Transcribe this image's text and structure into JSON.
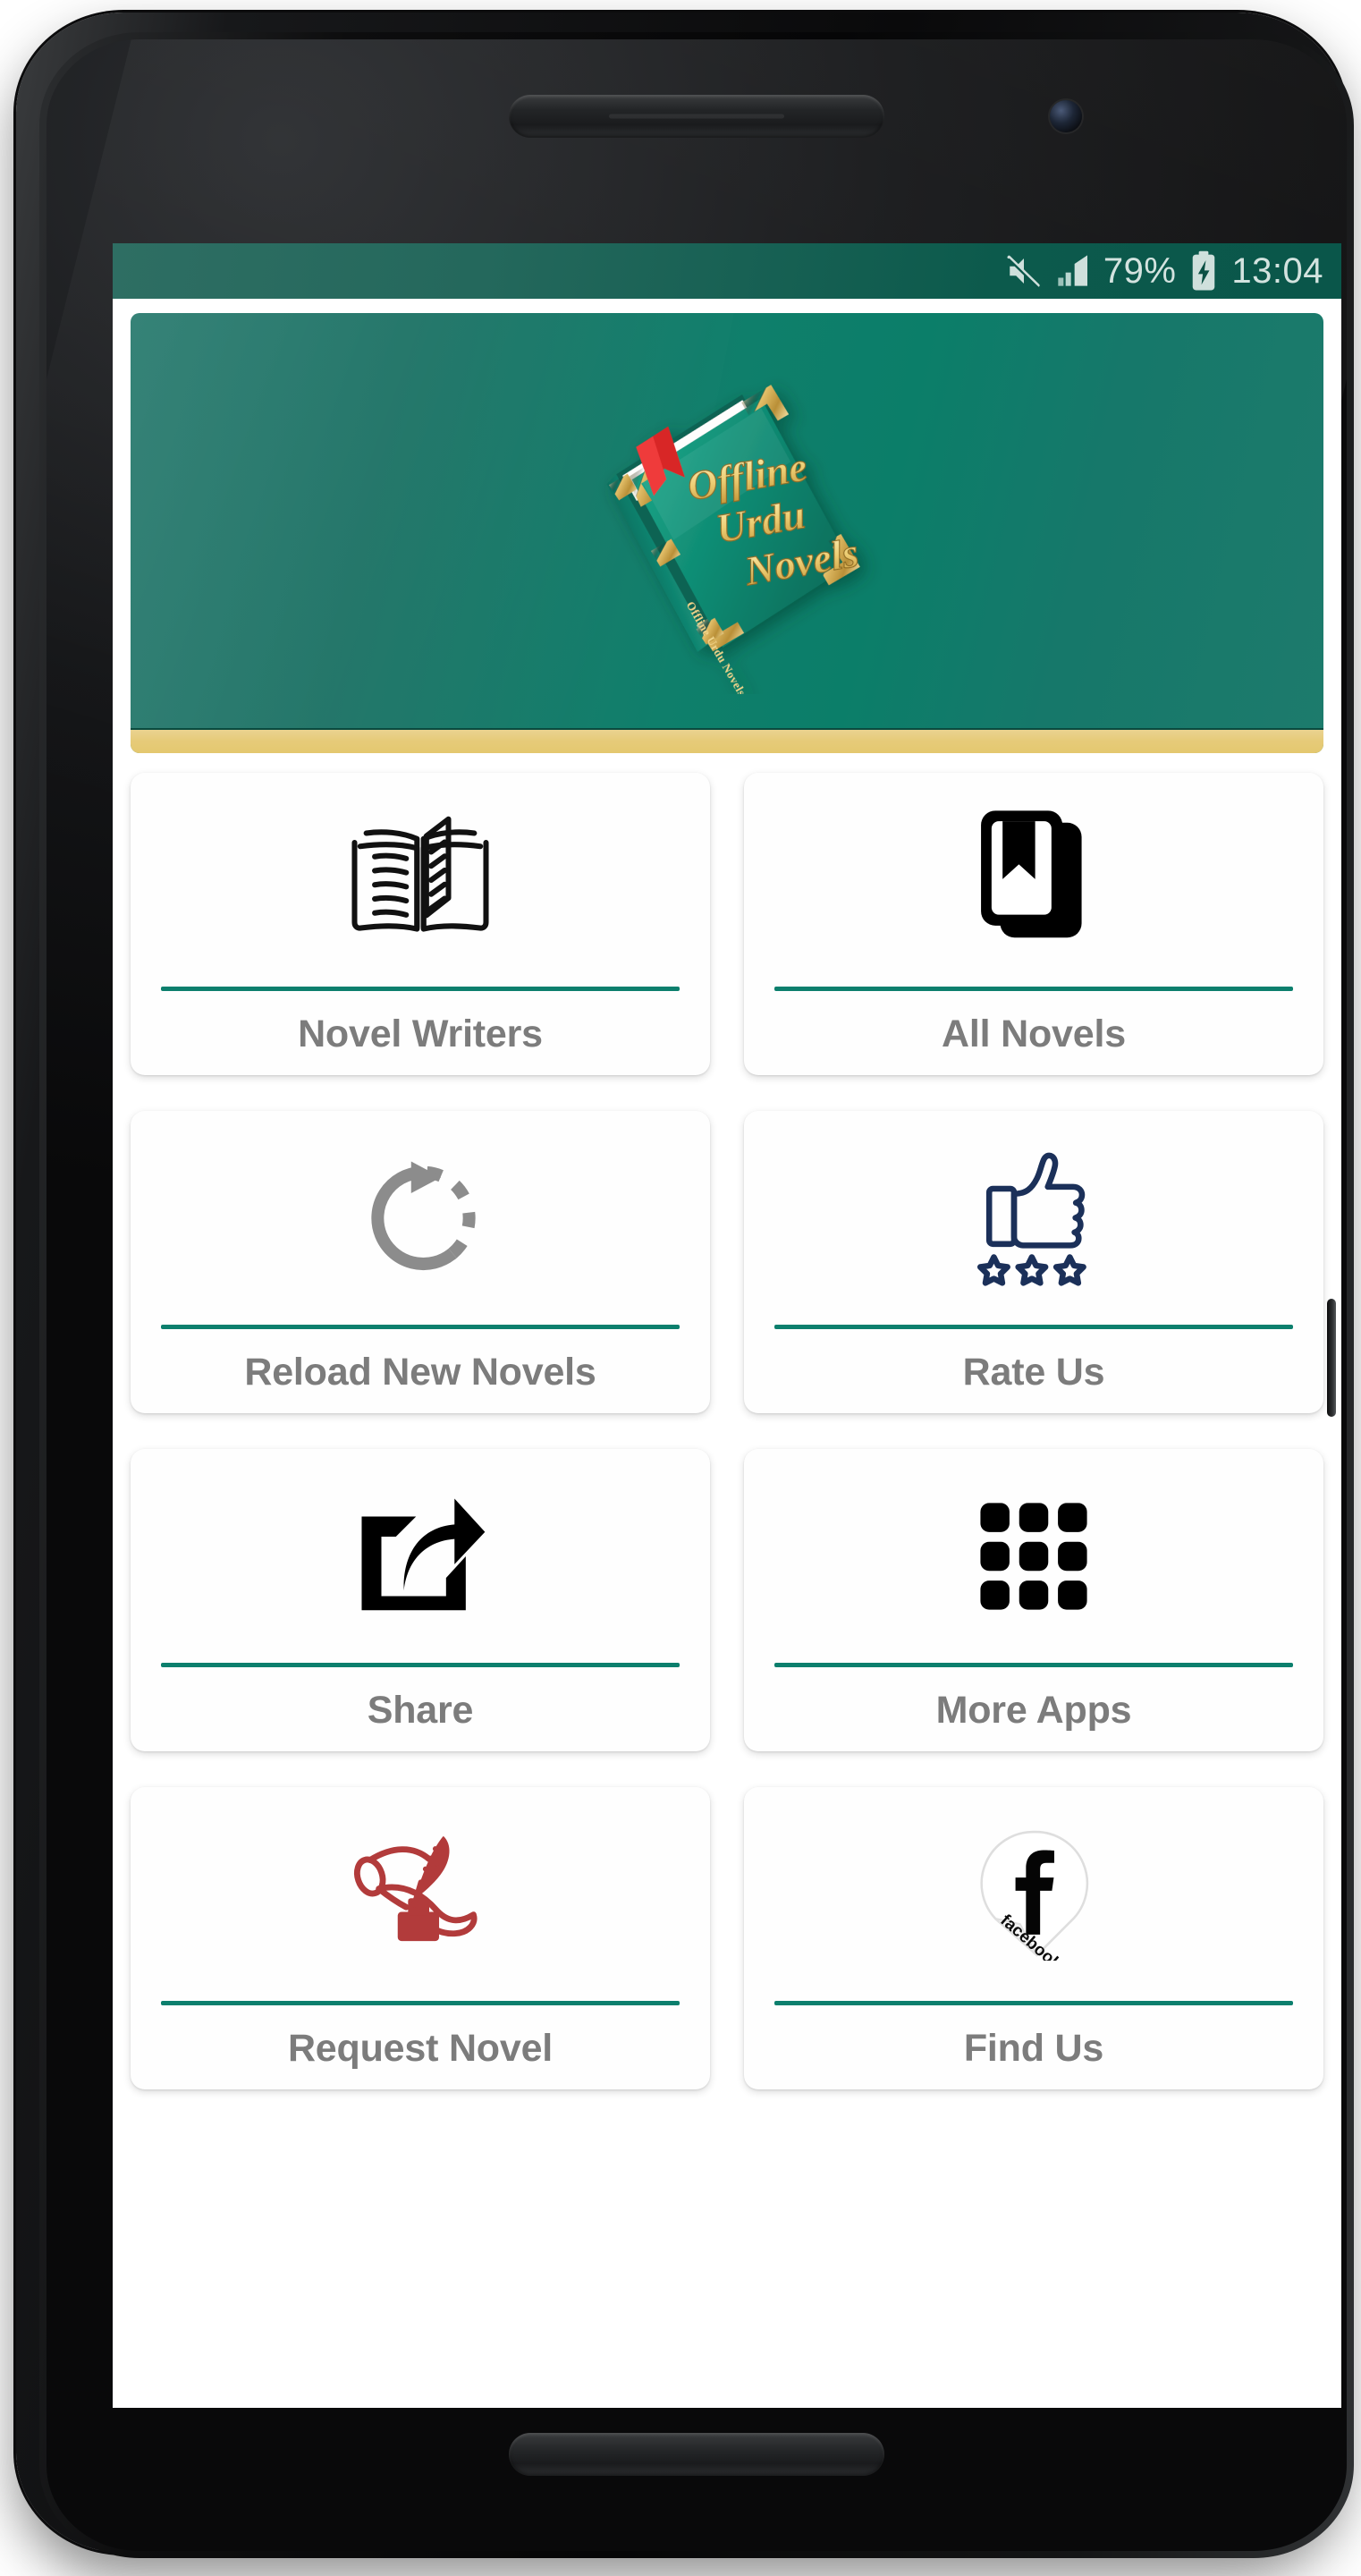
{
  "device": {
    "speaker_top": "earpiece-speaker",
    "speaker_bottom": "bottom-speaker",
    "camera": "front-camera",
    "side_button": "power-button"
  },
  "statusbar": {
    "background_color": "#0c5a4c",
    "mute_icon": "mute-volume-off-icon",
    "signal_icon": "signal-bars-icon",
    "battery_percent": "79%",
    "battery_icon": "battery-charging-icon",
    "clock": "13:04"
  },
  "banner": {
    "name": "app-logo-banner",
    "background_start": "#25786c",
    "background_end": "#0b7e69",
    "gold_strip_color": "#e6cb7a",
    "logo": {
      "alt": "offline-urdu-novels-book-logo",
      "line1": "Offline",
      "line2": "Urdu",
      "line3": "Novels",
      "spine_text": "Offline Urdu Novels",
      "text_color": "#f2d98a",
      "book_color": "#0d7e6b",
      "ribbon_color": "#d62020"
    }
  },
  "grid": {
    "accent_rule_color": "#0c7f6d",
    "label_color": "#7c7c7c",
    "items": [
      {
        "id": "novel-writers",
        "label": "Novel Writers",
        "icon": "open-book-icon",
        "icon_color": "#111111"
      },
      {
        "id": "all-novels",
        "label": "All Novels",
        "icon": "bookmark-book-icon",
        "icon_color": "#000000"
      },
      {
        "id": "reload-new-novels",
        "label": "Reload New Novels",
        "icon": "refresh-rotate-icon",
        "icon_color": "#8c8c8c"
      },
      {
        "id": "rate-us",
        "label": "Rate Us",
        "icon": "thumbs-up-stars-icon",
        "icon_color": "#1b3059"
      },
      {
        "id": "share",
        "label": "Share",
        "icon": "share-export-icon",
        "icon_color": "#000000"
      },
      {
        "id": "more-apps",
        "label": "More Apps",
        "icon": "apps-grid-icon",
        "icon_color": "#000000"
      },
      {
        "id": "request-novel",
        "label": "Request Novel",
        "icon": "quill-inkwell-icon",
        "icon_color": "#b23b3b"
      },
      {
        "id": "find-us",
        "label": "Find Us",
        "icon": "facebook-sticker-icon",
        "icon_color": "#000000",
        "icon_caption": "facebook",
        "icon_glyph": "f"
      }
    ]
  }
}
